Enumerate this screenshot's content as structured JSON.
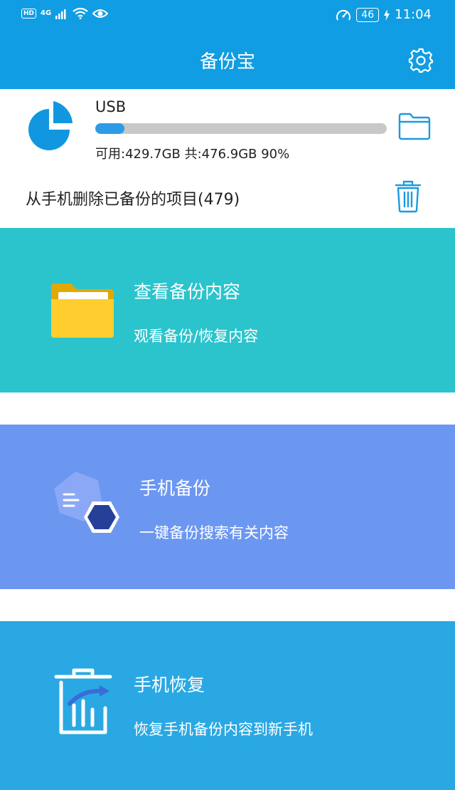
{
  "status_bar": {
    "left_badge": "HD",
    "network": "4G",
    "battery": "46",
    "time": "11:04"
  },
  "app_bar": {
    "title": "备份宝",
    "settings_icon": "gear-icon"
  },
  "storage": {
    "device_label": "USB",
    "usage_text": "可用:429.7GB 共:476.9GB  90%",
    "used_fraction": 0.1,
    "open_folder_icon": "folder-outline-icon",
    "delete_backed_up_label": "从手机删除已备份的项目(479)",
    "delete_icon": "trash-outline-icon"
  },
  "cards": {
    "view_backup": {
      "title": "查看备份内容",
      "subtitle": "观看备份/恢复内容",
      "icon": "folder-icon",
      "color": "#2bc4cd"
    },
    "phone_backup": {
      "title": "手机备份",
      "subtitle": "一键备份搜索有关内容",
      "icon": "hexagon-backup-icon",
      "color": "#6b97f1"
    },
    "phone_restore": {
      "title": "手机恢复",
      "subtitle": "恢复手机备份内容到新手机",
      "icon": "restore-bin-icon",
      "color": "#2aa8e3"
    }
  },
  "colors": {
    "app_bar": "#109de3",
    "accent": "#2d9be6"
  }
}
